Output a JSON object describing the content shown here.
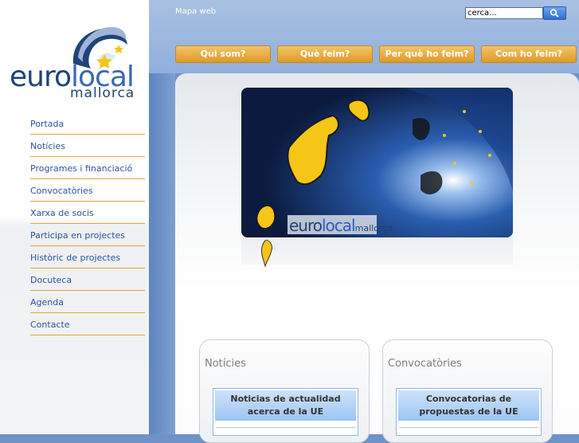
{
  "logo": {
    "euro": "euro",
    "local": "local",
    "sub": "mallorca"
  },
  "nav": [
    "Portada",
    "Notícies",
    "Programes i financiació",
    "Convocatòries",
    "Xarxa de socis",
    "Participa en projectes",
    "Històric de projectes",
    "Docuteca",
    "Agenda",
    "Contacte"
  ],
  "header": {
    "mapa_web": "Mapa web",
    "search_value": "cerca..."
  },
  "topnav": [
    "Qui som?",
    "Què feim?",
    "Per què ho feim?",
    "Com ho feim?"
  ],
  "banner": {
    "euro": "euro",
    "local": "local",
    "sub": "mallorca"
  },
  "panels": [
    {
      "title": "Notícies",
      "box": "Noticias de actualidad acerca de la UE"
    },
    {
      "title": "Convocatòries",
      "box": "Convocatorias de propuestas de la UE"
    }
  ],
  "colors": {
    "accent": "#e6a43a",
    "link": "#2a55a0",
    "brand": "#1f4477"
  }
}
